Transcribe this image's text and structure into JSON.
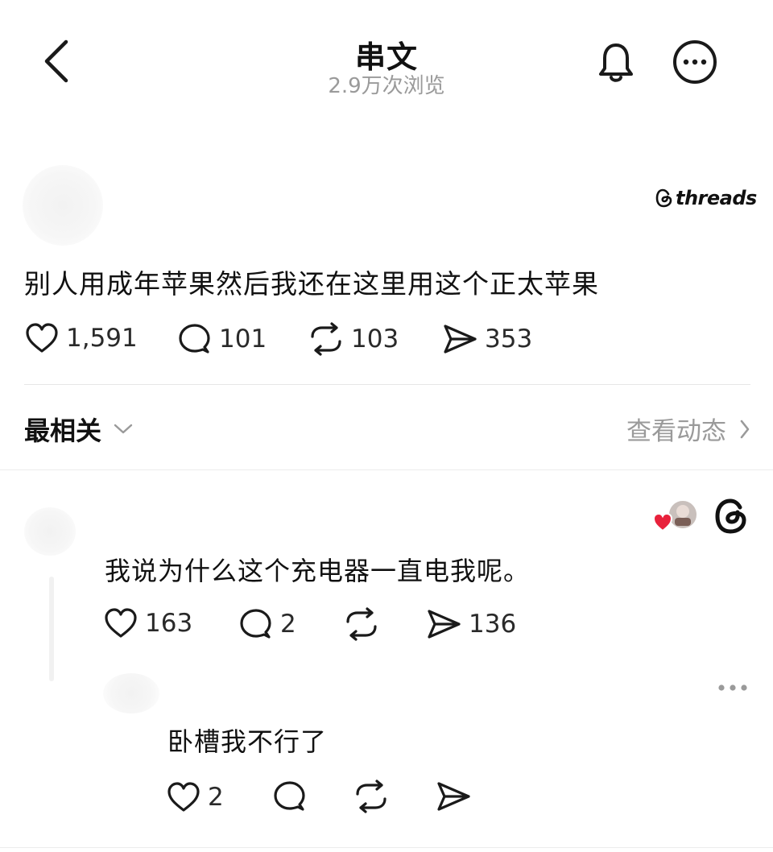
{
  "header": {
    "title": "串文",
    "views": "2.9万次浏览",
    "icons": [
      "back-arrow-icon",
      "bell-icon",
      "more-options-icon"
    ]
  },
  "post": {
    "badge": "threads",
    "text": "别人用成年苹果然后我还在这里用这个正太苹果",
    "stats": {
      "likes": "1,591",
      "comments": "101",
      "reposts": "103",
      "shares": "353"
    }
  },
  "sort": {
    "label": "最相关",
    "activity_link": "查看动态"
  },
  "comments": [
    {
      "text": "我说为什么这个充电器一直电我呢。",
      "stats": {
        "likes": "163",
        "comments": "2",
        "reposts": "",
        "shares": "136"
      }
    },
    {
      "text": "卧槽我不行了",
      "stats": {
        "likes": "2",
        "comments": "",
        "reposts": "",
        "shares": ""
      }
    }
  ],
  "colors": {
    "text": "#111111",
    "muted": "#9a9a9a",
    "heart_red": "#e8213b",
    "divider": "#e6e6e6"
  }
}
